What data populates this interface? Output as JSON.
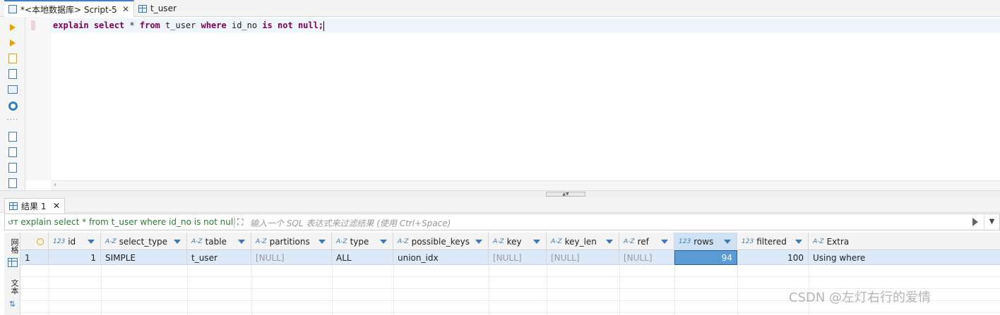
{
  "tabs": [
    {
      "label": "*<本地数据库> Script-5",
      "close": "✕"
    },
    {
      "label": "t_user"
    }
  ],
  "editor": {
    "sql_keyword_explain": "explain",
    "sql_keyword_select": "select",
    "sql_star": "*",
    "sql_keyword_from": "from",
    "sql_table": "t_user",
    "sql_keyword_where": "where",
    "sql_column": "id_no",
    "sql_keyword_is": "is",
    "sql_keyword_not": "not",
    "sql_keyword_null": "null;"
  },
  "results": {
    "tab_label": "结果 1",
    "tab_close": "✕",
    "query_text": "explain select * from t_user where id_no is not null",
    "filter_placeholder": "输入一个 SQL 表达式来过滤结果 (使用 Ctrl+Space)",
    "side_labels": [
      "网格",
      "文本"
    ],
    "columns": [
      {
        "type": "123",
        "name": "id"
      },
      {
        "type": "A-Z",
        "name": "select_type"
      },
      {
        "type": "A-Z",
        "name": "table"
      },
      {
        "type": "A-Z",
        "name": "partitions"
      },
      {
        "type": "A-Z",
        "name": "type"
      },
      {
        "type": "A-Z",
        "name": "possible_keys"
      },
      {
        "type": "A-Z",
        "name": "key"
      },
      {
        "type": "A-Z",
        "name": "key_len"
      },
      {
        "type": "A-Z",
        "name": "ref"
      },
      {
        "type": "123",
        "name": "rows"
      },
      {
        "type": "123",
        "name": "filtered"
      },
      {
        "type": "A-Z",
        "name": "Extra"
      }
    ],
    "rows": [
      {
        "rownum": "1",
        "cells": [
          "1",
          "SIMPLE",
          "t_user",
          "[NULL]",
          "ALL",
          "union_idx",
          "[NULL]",
          "[NULL]",
          "[NULL]",
          "94",
          "100",
          "Using where"
        ]
      }
    ]
  },
  "watermark": "CSDN @左灯右行的爱情",
  "colors": {
    "accent": "#3c7fc7",
    "keyword": "#7f0055",
    "query_green": "#2e7d32",
    "selected_cell": "#5b9bd5"
  }
}
